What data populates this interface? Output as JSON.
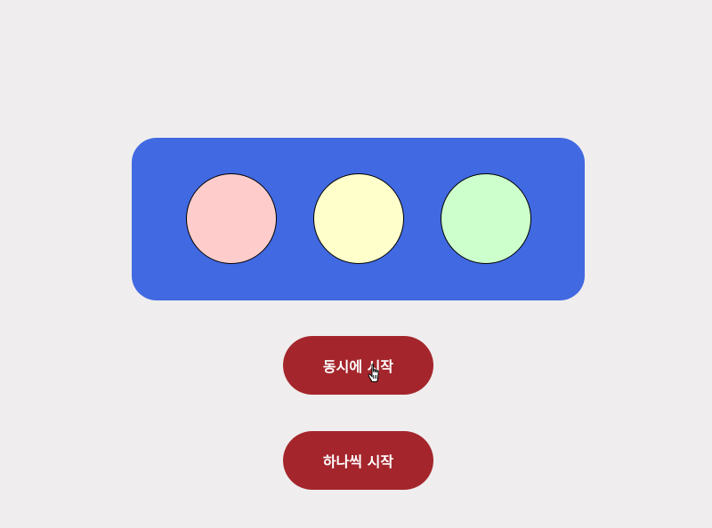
{
  "lights": [
    {
      "name": "red",
      "color": "#ffcccc"
    },
    {
      "name": "yellow",
      "color": "#ffffcc"
    },
    {
      "name": "green",
      "color": "#ccffcc"
    }
  ],
  "panel_color": "#4169e1",
  "button_color": "#a4262c",
  "buttons": {
    "simultaneous_label": "동시에 시작",
    "sequential_label": "하나씩 시작"
  },
  "cursor": {
    "icon": "hand-pointer-icon"
  }
}
